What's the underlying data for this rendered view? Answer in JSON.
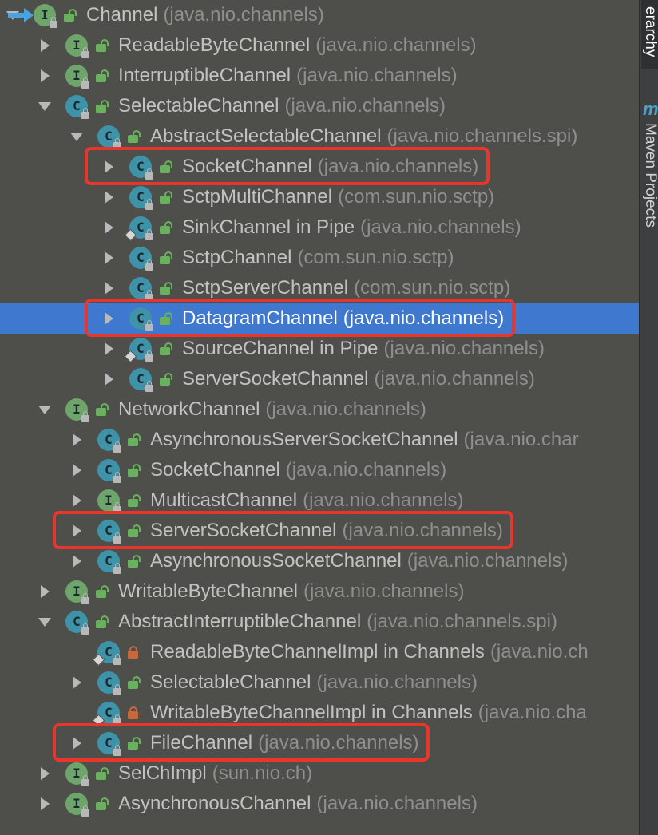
{
  "sidebar": {
    "hierarchy_tab": "erarchy",
    "maven_icon": "m",
    "maven_tab": "Maven Projects"
  },
  "tree": {
    "rows": [
      {
        "depth": 0,
        "arrow": "down",
        "kind": "interface",
        "letter": "I",
        "vis": "public",
        "name": "Channel",
        "pkg": "(java.nio.channels)",
        "pinned": true
      },
      {
        "depth": 1,
        "arrow": "right",
        "kind": "interface",
        "letter": "I",
        "vis": "public",
        "name": "ReadableByteChannel",
        "pkg": "(java.nio.channels)"
      },
      {
        "depth": 1,
        "arrow": "right",
        "kind": "interface",
        "letter": "I",
        "vis": "public",
        "name": "InterruptibleChannel",
        "pkg": "(java.nio.channels)"
      },
      {
        "depth": 1,
        "arrow": "down",
        "kind": "class",
        "letter": "C",
        "vis": "public",
        "name": "SelectableChannel",
        "pkg": "(java.nio.channels)"
      },
      {
        "depth": 2,
        "arrow": "down",
        "kind": "class",
        "letter": "C",
        "vis": "public",
        "name": "AbstractSelectableChannel",
        "pkg": "(java.nio.channels.spi)"
      },
      {
        "depth": 3,
        "arrow": "right",
        "kind": "class",
        "letter": "C",
        "vis": "public",
        "name": "SocketChannel",
        "pkg": "(java.nio.channels)"
      },
      {
        "depth": 3,
        "arrow": "right",
        "kind": "class",
        "letter": "C",
        "vis": "public",
        "name": "SctpMultiChannel",
        "pkg": "(com.sun.nio.sctp)"
      },
      {
        "depth": 3,
        "arrow": "right",
        "kind": "class",
        "letter": "C",
        "vis": "public",
        "name": "SinkChannel in Pipe",
        "pkg": "(java.nio.channels)",
        "inner": true
      },
      {
        "depth": 3,
        "arrow": "right",
        "kind": "class",
        "letter": "C",
        "vis": "public",
        "name": "SctpChannel",
        "pkg": "(com.sun.nio.sctp)"
      },
      {
        "depth": 3,
        "arrow": "right",
        "kind": "class",
        "letter": "C",
        "vis": "public",
        "name": "SctpServerChannel",
        "pkg": "(com.sun.nio.sctp)"
      },
      {
        "depth": 3,
        "arrow": "right",
        "kind": "class",
        "letter": "C",
        "vis": "public",
        "name": "DatagramChannel",
        "pkg": "(java.nio.channels)",
        "selected": true
      },
      {
        "depth": 3,
        "arrow": "right",
        "kind": "class",
        "letter": "C",
        "vis": "public",
        "name": "SourceChannel in Pipe",
        "pkg": "(java.nio.channels)",
        "inner": true
      },
      {
        "depth": 3,
        "arrow": "right",
        "kind": "class",
        "letter": "C",
        "vis": "public",
        "name": "ServerSocketChannel",
        "pkg": "(java.nio.channels)"
      },
      {
        "depth": 1,
        "arrow": "down",
        "kind": "interface",
        "letter": "I",
        "vis": "public",
        "name": "NetworkChannel",
        "pkg": "(java.nio.channels)"
      },
      {
        "depth": 2,
        "arrow": "right",
        "kind": "class",
        "letter": "C",
        "vis": "public",
        "name": "AsynchronousServerSocketChannel",
        "pkg": "(java.nio.char"
      },
      {
        "depth": 2,
        "arrow": "right",
        "kind": "class",
        "letter": "C",
        "vis": "public",
        "name": "SocketChannel",
        "pkg": "(java.nio.channels)"
      },
      {
        "depth": 2,
        "arrow": "right",
        "kind": "interface",
        "letter": "I",
        "vis": "public",
        "name": "MulticastChannel",
        "pkg": "(java.nio.channels)"
      },
      {
        "depth": 2,
        "arrow": "right",
        "kind": "class",
        "letter": "C",
        "vis": "public",
        "name": "ServerSocketChannel",
        "pkg": "(java.nio.channels)"
      },
      {
        "depth": 2,
        "arrow": "right",
        "kind": "class",
        "letter": "C",
        "vis": "public",
        "name": "AsynchronousSocketChannel",
        "pkg": "(java.nio.channels)"
      },
      {
        "depth": 1,
        "arrow": "right",
        "kind": "interface",
        "letter": "I",
        "vis": "public",
        "name": "WritableByteChannel",
        "pkg": "(java.nio.channels)"
      },
      {
        "depth": 1,
        "arrow": "down",
        "kind": "class",
        "letter": "C",
        "vis": "public",
        "name": "AbstractInterruptibleChannel",
        "pkg": "(java.nio.channels.spi)"
      },
      {
        "depth": 2,
        "arrow": "none",
        "kind": "class",
        "letter": "C",
        "vis": "private",
        "name": "ReadableByteChannelImpl in Channels",
        "pkg": "(java.nio.ch",
        "inner": true
      },
      {
        "depth": 2,
        "arrow": "right",
        "kind": "class",
        "letter": "C",
        "vis": "public",
        "name": "SelectableChannel",
        "pkg": "(java.nio.channels)"
      },
      {
        "depth": 2,
        "arrow": "none",
        "kind": "class",
        "letter": "C",
        "vis": "private",
        "name": "WritableByteChannelImpl in Channels",
        "pkg": "(java.nio.cha",
        "inner": true
      },
      {
        "depth": 2,
        "arrow": "right",
        "kind": "class",
        "letter": "C",
        "vis": "public",
        "name": "FileChannel",
        "pkg": "(java.nio.channels)"
      },
      {
        "depth": 1,
        "arrow": "right",
        "kind": "interface",
        "letter": "I",
        "vis": "public",
        "name": "SelChImpl",
        "pkg": "(sun.nio.ch)"
      },
      {
        "depth": 1,
        "arrow": "right",
        "kind": "interface",
        "letter": "I",
        "vis": "public",
        "name": "AsynchronousChannel",
        "pkg": "(java.nio.channels)"
      }
    ]
  },
  "highlights": [
    {
      "label": "SocketChannel",
      "row": 5
    },
    {
      "label": "DatagramChannel",
      "row": 10
    },
    {
      "label": "ServerSocketChannel",
      "row": 17
    },
    {
      "label": "FileChannel",
      "row": 24
    }
  ]
}
